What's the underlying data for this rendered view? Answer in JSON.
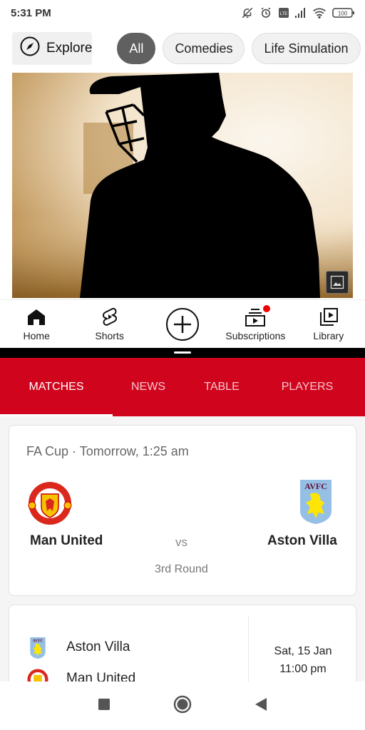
{
  "status_bar": {
    "time": "5:31 PM",
    "icons": [
      "bell-muted-icon",
      "alarm-icon",
      "volte-icon",
      "signal-icon",
      "wifi-icon",
      "battery-icon"
    ],
    "battery": "100"
  },
  "chips": {
    "explore_label": "Explore",
    "items": [
      {
        "label": "All",
        "active": true
      },
      {
        "label": "Comedies",
        "active": false
      },
      {
        "label": "Life Simulation",
        "active": false
      }
    ]
  },
  "hero": {
    "subject": "silhouette of cricket player in helmet",
    "overlay_icon": "image-icon"
  },
  "bottom_nav": {
    "items": [
      {
        "label": "Home",
        "icon": "home-icon"
      },
      {
        "label": "Shorts",
        "icon": "shorts-icon"
      },
      {
        "label": "",
        "icon": "create-plus-icon"
      },
      {
        "label": "Subscriptions",
        "icon": "subscriptions-icon",
        "badge": true
      },
      {
        "label": "Library",
        "icon": "library-icon"
      }
    ]
  },
  "sports": {
    "brand_color": "#d1041d",
    "tabs": [
      {
        "label": "MATCHES",
        "active": true
      },
      {
        "label": "NEWS",
        "active": false
      },
      {
        "label": "TABLE",
        "active": false
      },
      {
        "label": "PLAYERS",
        "active": false
      }
    ],
    "featured_match": {
      "meta": "FA Cup · Tomorrow, 1:25 am",
      "home_team": "Man United",
      "away_team": "Aston Villa",
      "vs": "vs",
      "round": "3rd Round"
    },
    "next_match": {
      "team1": "Aston Villa",
      "team2": "Man United",
      "date": "Sat, 15 Jan",
      "time": "11:00 pm"
    }
  },
  "system_nav": {
    "buttons": [
      "recents-button",
      "home-button",
      "back-button"
    ]
  }
}
